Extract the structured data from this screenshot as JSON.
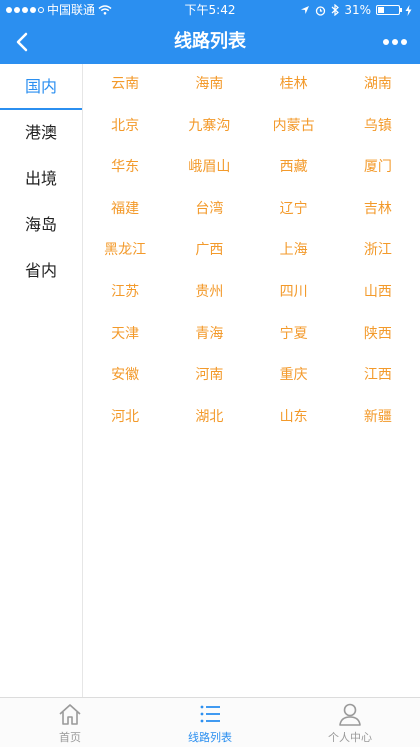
{
  "status_bar": {
    "carrier": "中国联通",
    "time": "下午5:42",
    "battery": "31%",
    "battery_fraction": 0.31
  },
  "nav": {
    "title": "线路列表",
    "back_icon": "back-chevron-icon",
    "more_icon": "more-dots-icon"
  },
  "sidebar": {
    "items": [
      {
        "label": "国内",
        "active": true
      },
      {
        "label": "港澳",
        "active": false
      },
      {
        "label": "出境",
        "active": false
      },
      {
        "label": "海岛",
        "active": false
      },
      {
        "label": "省内",
        "active": false
      }
    ]
  },
  "regions": [
    "云南",
    "海南",
    "桂林",
    "湖南",
    "北京",
    "九寨沟",
    "内蒙古",
    "乌镇",
    "华东",
    "峨眉山",
    "西藏",
    "厦门",
    "福建",
    "台湾",
    "辽宁",
    "吉林",
    "黑龙江",
    "广西",
    "上海",
    "浙江",
    "江苏",
    "贵州",
    "四川",
    "山西",
    "天津",
    "青海",
    "宁夏",
    "陕西",
    "安徽",
    "河南",
    "重庆",
    "江西",
    "河北",
    "湖北",
    "山东",
    "新疆"
  ],
  "tabbar": {
    "items": [
      {
        "label": "首页",
        "icon": "home-icon",
        "active": false
      },
      {
        "label": "线路列表",
        "icon": "list-icon",
        "active": true
      },
      {
        "label": "个人中心",
        "icon": "user-icon",
        "active": false
      }
    ]
  },
  "colors": {
    "primary": "#2b8ff0",
    "region_text": "#f39a2b"
  }
}
